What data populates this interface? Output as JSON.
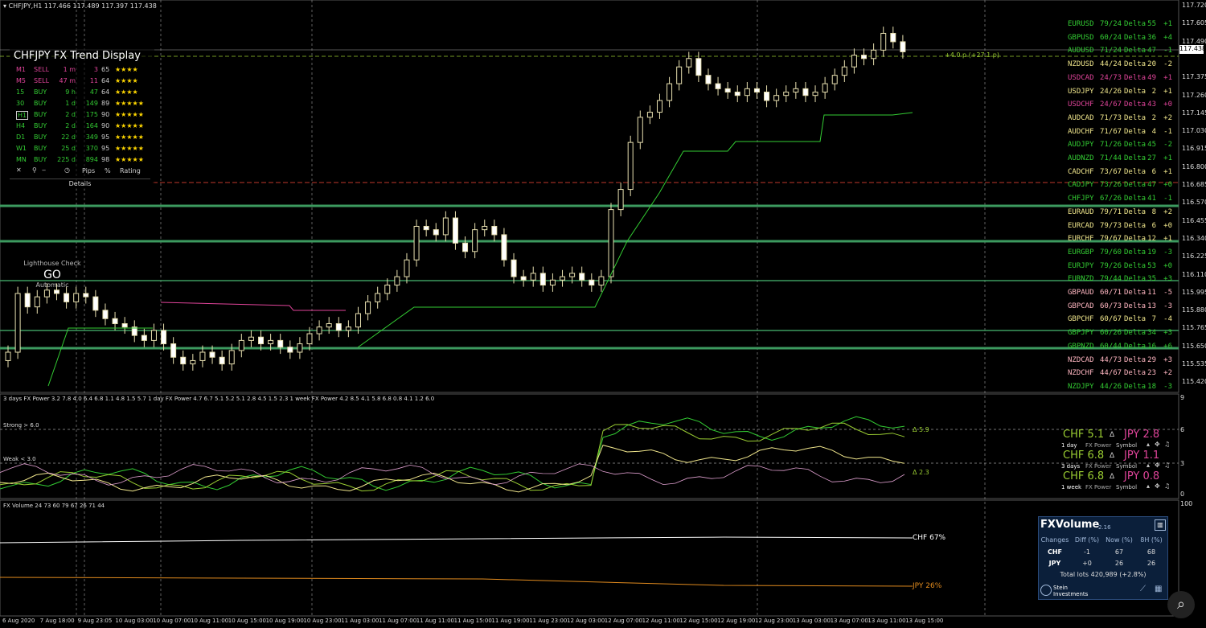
{
  "chart_title": "CHFJPY,H1  117.466 117.489 117.397 117.438",
  "colors": {
    "bull": "#000000",
    "bear": "#ffffff",
    "wick": "#e8e0b0",
    "green": "#33cc33",
    "pink": "#e0449a",
    "grid": "#888888",
    "bg": "#000000"
  },
  "price_axis": [
    "117.720",
    "117.605",
    "117.490",
    "117.438",
    "117.375",
    "117.260",
    "117.145",
    "117.030",
    "116.915",
    "116.800",
    "116.685",
    "116.570",
    "116.455",
    "116.340",
    "116.225",
    "116.110",
    "115.995",
    "115.880",
    "115.765",
    "115.650",
    "115.535",
    "115.420"
  ],
  "current_price": "117.438",
  "price_annotation": "+4.0 p (+27.1 p)",
  "trend_display": {
    "title": "CHFJPY FX Trend Display",
    "rows": [
      {
        "tf": "M1",
        "dir": "SELL",
        "time": "1 m",
        "pips": "3",
        "pct": "65",
        "stars": "★★★★",
        "color": "#e0449a"
      },
      {
        "tf": "M5",
        "dir": "SELL",
        "time": "47 m",
        "pips": "11",
        "pct": "64",
        "stars": "★★★★",
        "color": "#e0449a"
      },
      {
        "tf": "15",
        "dir": "BUY",
        "time": "9 h",
        "pips": "47",
        "pct": "64",
        "stars": "★★★★",
        "color": "#33cc33"
      },
      {
        "tf": "30",
        "dir": "BUY",
        "time": "1 d",
        "pips": "149",
        "pct": "89",
        "stars": "★★★★★",
        "color": "#33cc33"
      },
      {
        "tf": "H1",
        "dir": "BUY",
        "time": "2 d",
        "pips": "175",
        "pct": "90",
        "stars": "★★★★★",
        "color": "#33cc33"
      },
      {
        "tf": "H4",
        "dir": "BUY",
        "time": "2 d",
        "pips": "164",
        "pct": "90",
        "stars": "★★★★★",
        "color": "#33cc33"
      },
      {
        "tf": "D1",
        "dir": "BUY",
        "time": "22 d",
        "pips": "349",
        "pct": "95",
        "stars": "★★★★★",
        "color": "#33cc33"
      },
      {
        "tf": "W1",
        "dir": "BUY",
        "time": "25 d",
        "pips": "370",
        "pct": "95",
        "stars": "★★★★★",
        "color": "#33cc33"
      },
      {
        "tf": "MN",
        "dir": "BUY",
        "time": "225 d",
        "pips": "894",
        "pct": "98",
        "stars": "★★★★★",
        "color": "#33cc33"
      }
    ],
    "footer_pips": "Pips",
    "footer_pct": "%",
    "footer_rating": "Rating",
    "details": "Details"
  },
  "lighthouse": {
    "title": "Lighthouse Check",
    "status": "GO",
    "mode": "Automatic"
  },
  "pairs": [
    {
      "name": "EURUSD",
      "ratio": "79/24",
      "delta": "55",
      "chg": "+1",
      "color": "#33cc33"
    },
    {
      "name": "GBPUSD",
      "ratio": "60/24",
      "delta": "36",
      "chg": "+4",
      "color": "#33cc33"
    },
    {
      "name": "AUDUSD",
      "ratio": "71/24",
      "delta": "47",
      "chg": "-1",
      "color": "#33cc33"
    },
    {
      "name": "NZDUSD",
      "ratio": "44/24",
      "delta": "20",
      "chg": "-2",
      "color": "#f0e68c"
    },
    {
      "name": "USDCAD",
      "ratio": "24/73",
      "delta": "49",
      "chg": "+1",
      "color": "#e0449a"
    },
    {
      "name": "USDJPY",
      "ratio": "24/26",
      "delta": "2",
      "chg": "+1",
      "color": "#f0e68c"
    },
    {
      "name": "USDCHF",
      "ratio": "24/67",
      "delta": "43",
      "chg": "+0",
      "color": "#e0449a"
    },
    {
      "name": "AUDCAD",
      "ratio": "71/73",
      "delta": "2",
      "chg": "+2",
      "color": "#f0e68c"
    },
    {
      "name": "AUDCHF",
      "ratio": "71/67",
      "delta": "4",
      "chg": "-1",
      "color": "#f0e68c"
    },
    {
      "name": "AUDJPY",
      "ratio": "71/26",
      "delta": "45",
      "chg": "-2",
      "color": "#33cc33"
    },
    {
      "name": "AUDNZD",
      "ratio": "71/44",
      "delta": "27",
      "chg": "+1",
      "color": "#33cc33"
    },
    {
      "name": "CADCHF",
      "ratio": "73/67",
      "delta": "6",
      "chg": "+1",
      "color": "#f0e68c"
    },
    {
      "name": "CADJPY",
      "ratio": "73/26",
      "delta": "47",
      "chg": "+0",
      "color": "#33cc33"
    },
    {
      "name": "CHFJPY",
      "ratio": "67/26",
      "delta": "41",
      "chg": "-1",
      "color": "#33cc33"
    },
    {
      "name": "EURAUD",
      "ratio": "79/71",
      "delta": "8",
      "chg": "+2",
      "color": "#f0e68c"
    },
    {
      "name": "EURCAD",
      "ratio": "79/73",
      "delta": "6",
      "chg": "+0",
      "color": "#f0e68c"
    },
    {
      "name": "EURCHF",
      "ratio": "79/67",
      "delta": "12",
      "chg": "+1",
      "color": "#f0e68c"
    },
    {
      "name": "EURGBP",
      "ratio": "79/60",
      "delta": "19",
      "chg": "-3",
      "color": "#33cc33"
    },
    {
      "name": "EURJPY",
      "ratio": "79/26",
      "delta": "53",
      "chg": "+0",
      "color": "#33cc33"
    },
    {
      "name": "EURNZD",
      "ratio": "79/44",
      "delta": "35",
      "chg": "+3",
      "color": "#33cc33"
    },
    {
      "name": "GBPAUD",
      "ratio": "60/71",
      "delta": "11",
      "chg": "-5",
      "color": "#ffb6c1"
    },
    {
      "name": "GBPCAD",
      "ratio": "60/73",
      "delta": "13",
      "chg": "-3",
      "color": "#ffb6c1"
    },
    {
      "name": "GBPCHF",
      "ratio": "60/67",
      "delta": "7",
      "chg": "-4",
      "color": "#f0e68c"
    },
    {
      "name": "GBPJPY",
      "ratio": "60/26",
      "delta": "34",
      "chg": "+3",
      "color": "#33cc33"
    },
    {
      "name": "GBPNZD",
      "ratio": "60/44",
      "delta": "16",
      "chg": "+6",
      "color": "#33cc33"
    },
    {
      "name": "NZDCAD",
      "ratio": "44/73",
      "delta": "29",
      "chg": "+3",
      "color": "#ffb6c1"
    },
    {
      "name": "NZDCHF",
      "ratio": "44/67",
      "delta": "23",
      "chg": "+2",
      "color": "#ffb6c1"
    },
    {
      "name": "NZDJPY",
      "ratio": "44/26",
      "delta": "18",
      "chg": "-3",
      "color": "#33cc33"
    }
  ],
  "power_panel": {
    "header": "3 days FX Power 3.2 7.8 4.0 6.4 6.8 1.1 4.8 1.5 5.7     1 day FX Power 4.7 6.7 5.1 5.2 5.1 2.8 4.5 1.5 2.3     1 week FX Power 4.2 8.5 4.1 5.8 6.8 0.8 4.1 1.2 6.0",
    "strong": "Strong > 6.0",
    "weak": "Weak < 3.0",
    "axis": [
      "9",
      "6",
      "3",
      "0"
    ],
    "delta_top": "Δ 5.9",
    "delta_low": "Δ 2.3",
    "blocks": [
      {
        "base": "CHF 5.1",
        "quote": "JPY 2.8",
        "period": "1 day",
        "label": "FX Power",
        "sym": "Symbol"
      },
      {
        "base": "CHF 6.8",
        "quote": "JPY 1.1",
        "period": "3 days",
        "label": "FX Power",
        "sym": "Symbol"
      },
      {
        "base": "CHF 6.8",
        "quote": "JPY 0.8",
        "period": "1 week",
        "label": "FX Power",
        "sym": "Symbol"
      }
    ],
    "delta_sign": "Δ"
  },
  "volume_panel": {
    "header": "FX Volume 24 73 60 79 67 26 71 44",
    "axis": [
      "100",
      "0"
    ],
    "chf_label": "CHF 67%",
    "jpy_label": "JPY 26%"
  },
  "fxvolume_box": {
    "title": "FXVolume",
    "version": "2.16",
    "cols": [
      "Changes",
      "Diff (%)",
      "Now (%)",
      "8H (%)"
    ],
    "rows": [
      [
        "CHF",
        "-1",
        "67",
        "68"
      ],
      [
        "JPY",
        "+0",
        "26",
        "26"
      ]
    ],
    "total": "Total lots 420,989 (+2.8%)",
    "brand": "Stein Investments"
  },
  "time_axis": [
    "6 Aug 2020",
    "7 Aug 18:00",
    "9 Aug 23:05",
    "10 Aug 03:00",
    "10 Aug 07:00",
    "10 Aug 11:00",
    "10 Aug 15:00",
    "10 Aug 19:00",
    "10 Aug 23:00",
    "11 Aug 03:00",
    "11 Aug 07:00",
    "11 Aug 11:00",
    "11 Aug 15:00",
    "11 Aug 19:00",
    "11 Aug 23:00",
    "12 Aug 03:00",
    "12 Aug 07:00",
    "12 Aug 11:00",
    "12 Aug 15:00",
    "12 Aug 19:00",
    "12 Aug 23:00",
    "13 Aug 03:00",
    "13 Aug 07:00",
    "13 Aug 11:00",
    "13 Aug 15:00"
  ],
  "chart_data": {
    "type": "candlestick",
    "symbol": "CHFJPY,H1",
    "ylim": [
      115.42,
      117.72
    ],
    "closes": [
      115.65,
      116.0,
      115.92,
      115.98,
      116.02,
      116.0,
      115.95,
      116.0,
      115.98,
      115.9,
      115.85,
      115.82,
      115.8,
      115.75,
      115.72,
      115.78,
      115.7,
      115.62,
      115.58,
      115.6,
      115.65,
      115.62,
      115.58,
      115.66,
      115.72,
      115.74,
      115.7,
      115.72,
      115.68,
      115.65,
      115.7,
      115.76,
      115.8,
      115.82,
      115.78,
      115.8,
      115.88,
      115.95,
      116.0,
      116.05,
      116.1,
      116.2,
      116.4,
      116.38,
      116.35,
      116.45,
      116.3,
      116.25,
      116.38,
      116.4,
      116.35,
      116.2,
      116.1,
      116.08,
      116.12,
      116.05,
      116.08,
      116.1,
      116.12,
      116.08,
      116.05,
      116.1,
      116.5,
      116.62,
      116.9,
      117.05,
      117.08,
      117.15,
      117.25,
      117.35,
      117.4,
      117.3,
      117.25,
      117.22,
      117.2,
      117.18,
      117.22,
      117.2,
      117.15,
      117.18,
      117.2,
      117.22,
      117.18,
      117.2,
      117.25,
      117.3,
      117.35,
      117.42,
      117.4,
      117.45,
      117.55,
      117.5,
      117.44
    ]
  }
}
